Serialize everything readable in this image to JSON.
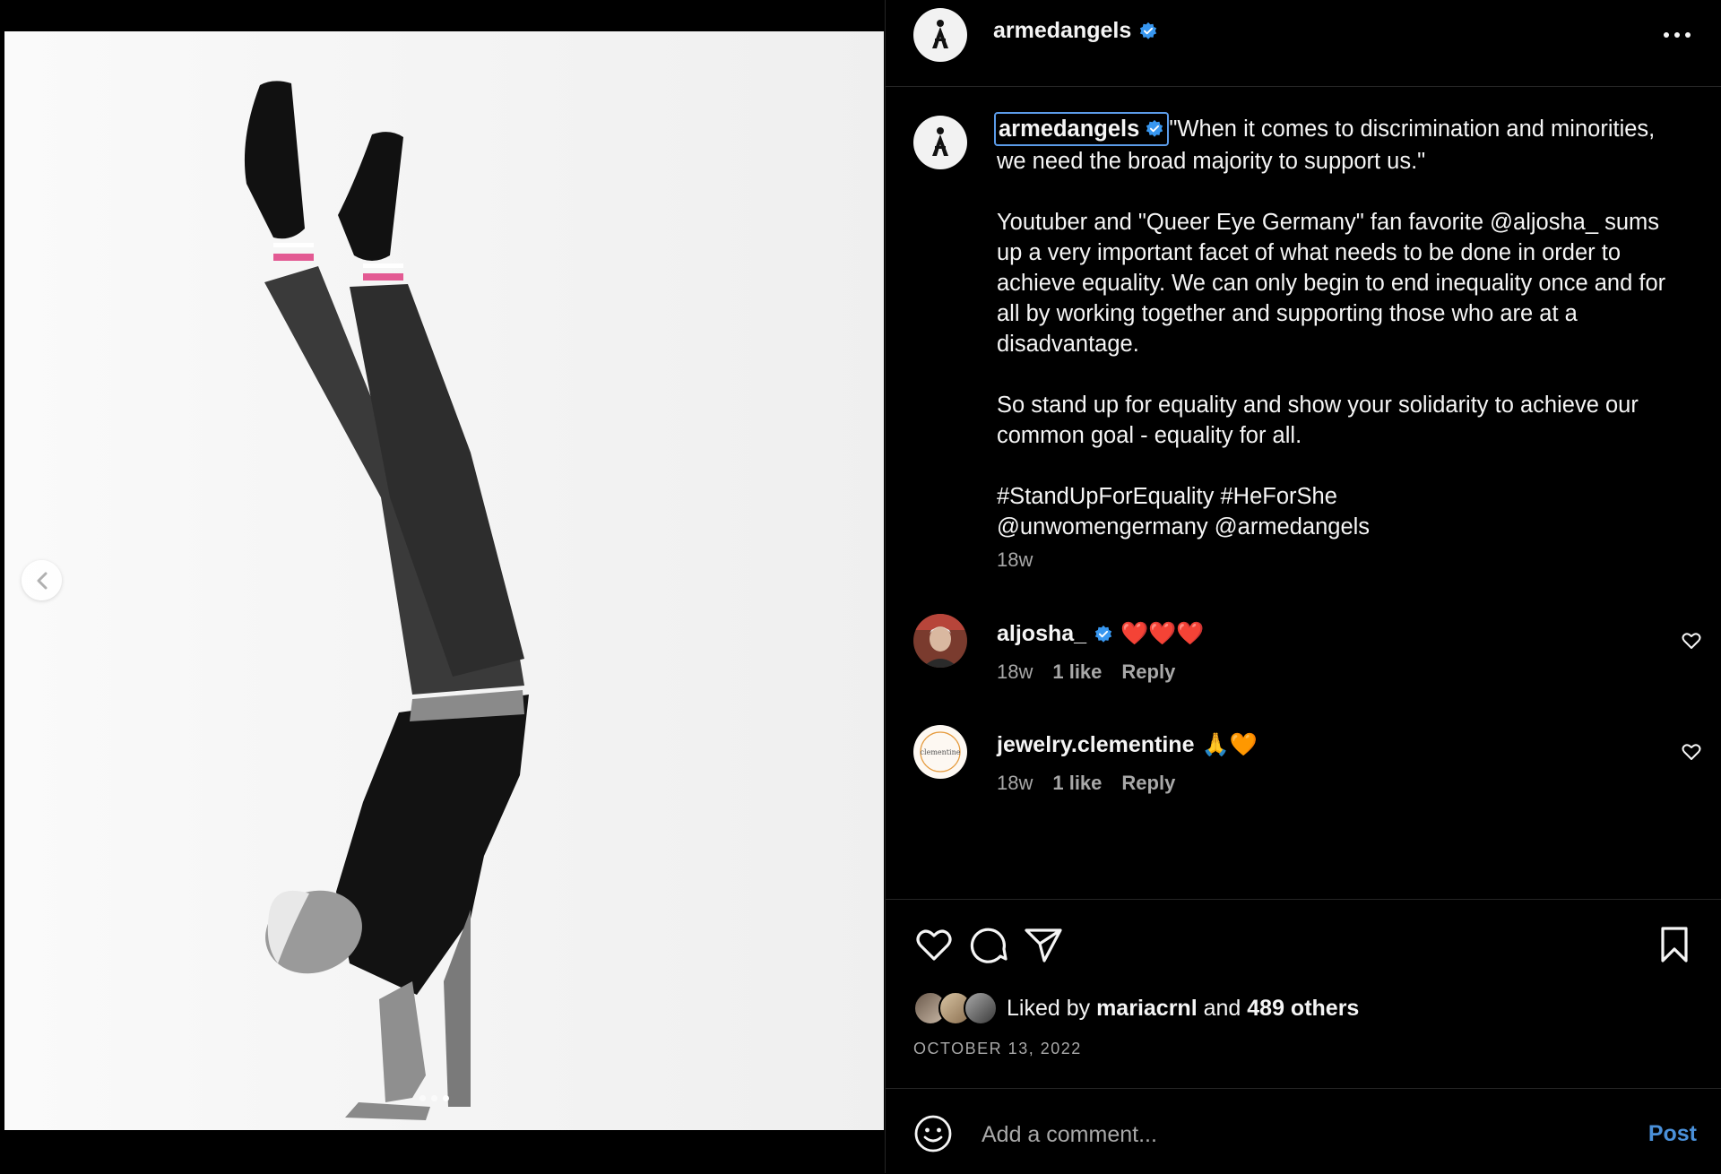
{
  "colors": {
    "accent": "#0095f6",
    "post_button": "#4a90d9",
    "muted": "#a8a8a8",
    "verified": "#3897f0",
    "heart": "#e0245e"
  },
  "media": {
    "carousel_dots": 3,
    "active_dot": 3,
    "prev_icon": "chevron-left-icon"
  },
  "header": {
    "username": "armedangels",
    "verified_icon": "verified-badge-icon",
    "more_icon": "more-horizontal-icon"
  },
  "caption": {
    "username": "armedangels",
    "paragraphs": [
      "\"When it comes to discrimination and minorities, we need the broad majority to support us.\"",
      "Youtuber and \"Queer Eye Germany\" fan favorite @aljosha_ sums up a very important facet of what needs to be done in order to achieve equality. We can only begin to end inequality once and for all by working together and supporting those who are at a disadvantage.",
      "So stand up for equality and show your solidarity to achieve our common goal - equality for all.",
      "#StandUpForEquality #HeForShe\n@unwomengermany @armedangels"
    ],
    "time": "18w"
  },
  "comments": [
    {
      "username": "aljosha_",
      "verified": true,
      "text": "❤️❤️❤️",
      "time": "18w",
      "likes": "1 like",
      "reply": "Reply"
    },
    {
      "username": "jewelry.clementine",
      "verified": false,
      "text": "🙏🧡",
      "time": "18w",
      "likes": "1 like",
      "reply": "Reply",
      "avatar_text": "clementine"
    }
  ],
  "actions": {
    "icons": [
      "heart-icon",
      "comment-icon",
      "share-icon",
      "bookmark-icon"
    ],
    "liked_by_prefix": "Liked by",
    "liked_by_user": "mariacrnl",
    "liked_by_and": "and",
    "liked_by_others": "489 others",
    "date": "OCTOBER 13, 2022"
  },
  "comment_bar": {
    "placeholder": "Add a comment...",
    "post_label": "Post",
    "emoji_icon": "emoji-icon"
  }
}
